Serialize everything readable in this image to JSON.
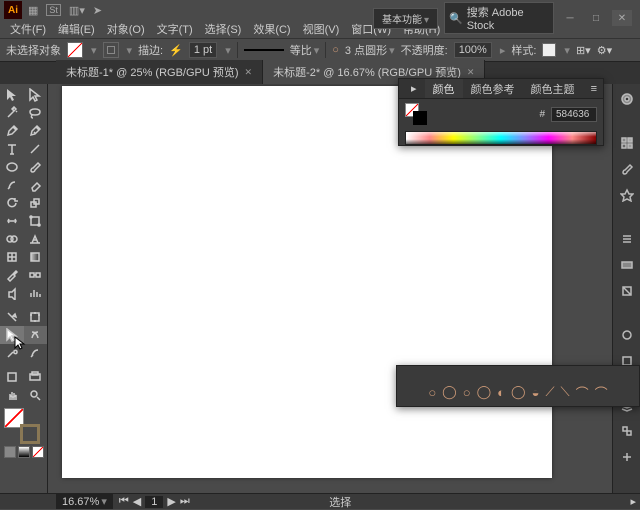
{
  "title": {
    "logo": "Ai",
    "workspace": "基本功能",
    "search_placeholder": "搜索 Adobe Stock"
  },
  "menu": [
    "文件(F)",
    "编辑(E)",
    "对象(O)",
    "文字(T)",
    "选择(S)",
    "效果(C)",
    "视图(V)",
    "窗口(W)",
    "帮助(H)"
  ],
  "ctrl": {
    "noselect": "未选择对象",
    "stroke_label": "描边:",
    "stroke_val": "1 pt",
    "uniform": "等比",
    "shape_label": "3 点圆形",
    "opacity_label": "不透明度:",
    "opacity_val": "100%",
    "style_label": "样式:"
  },
  "tabs": [
    {
      "label": "未标题-1* @ 25% (RGB/GPU 预览)",
      "active": false
    },
    {
      "label": "未标题-2* @ 16.67% (RGB/GPU 预览)",
      "active": true
    }
  ],
  "color_panel": {
    "tabs": [
      "颜色",
      "颜色参考",
      "颜色主题"
    ],
    "hex": "584636"
  },
  "status": {
    "zoom": "16.67%",
    "page": "1",
    "mode": "选择"
  }
}
